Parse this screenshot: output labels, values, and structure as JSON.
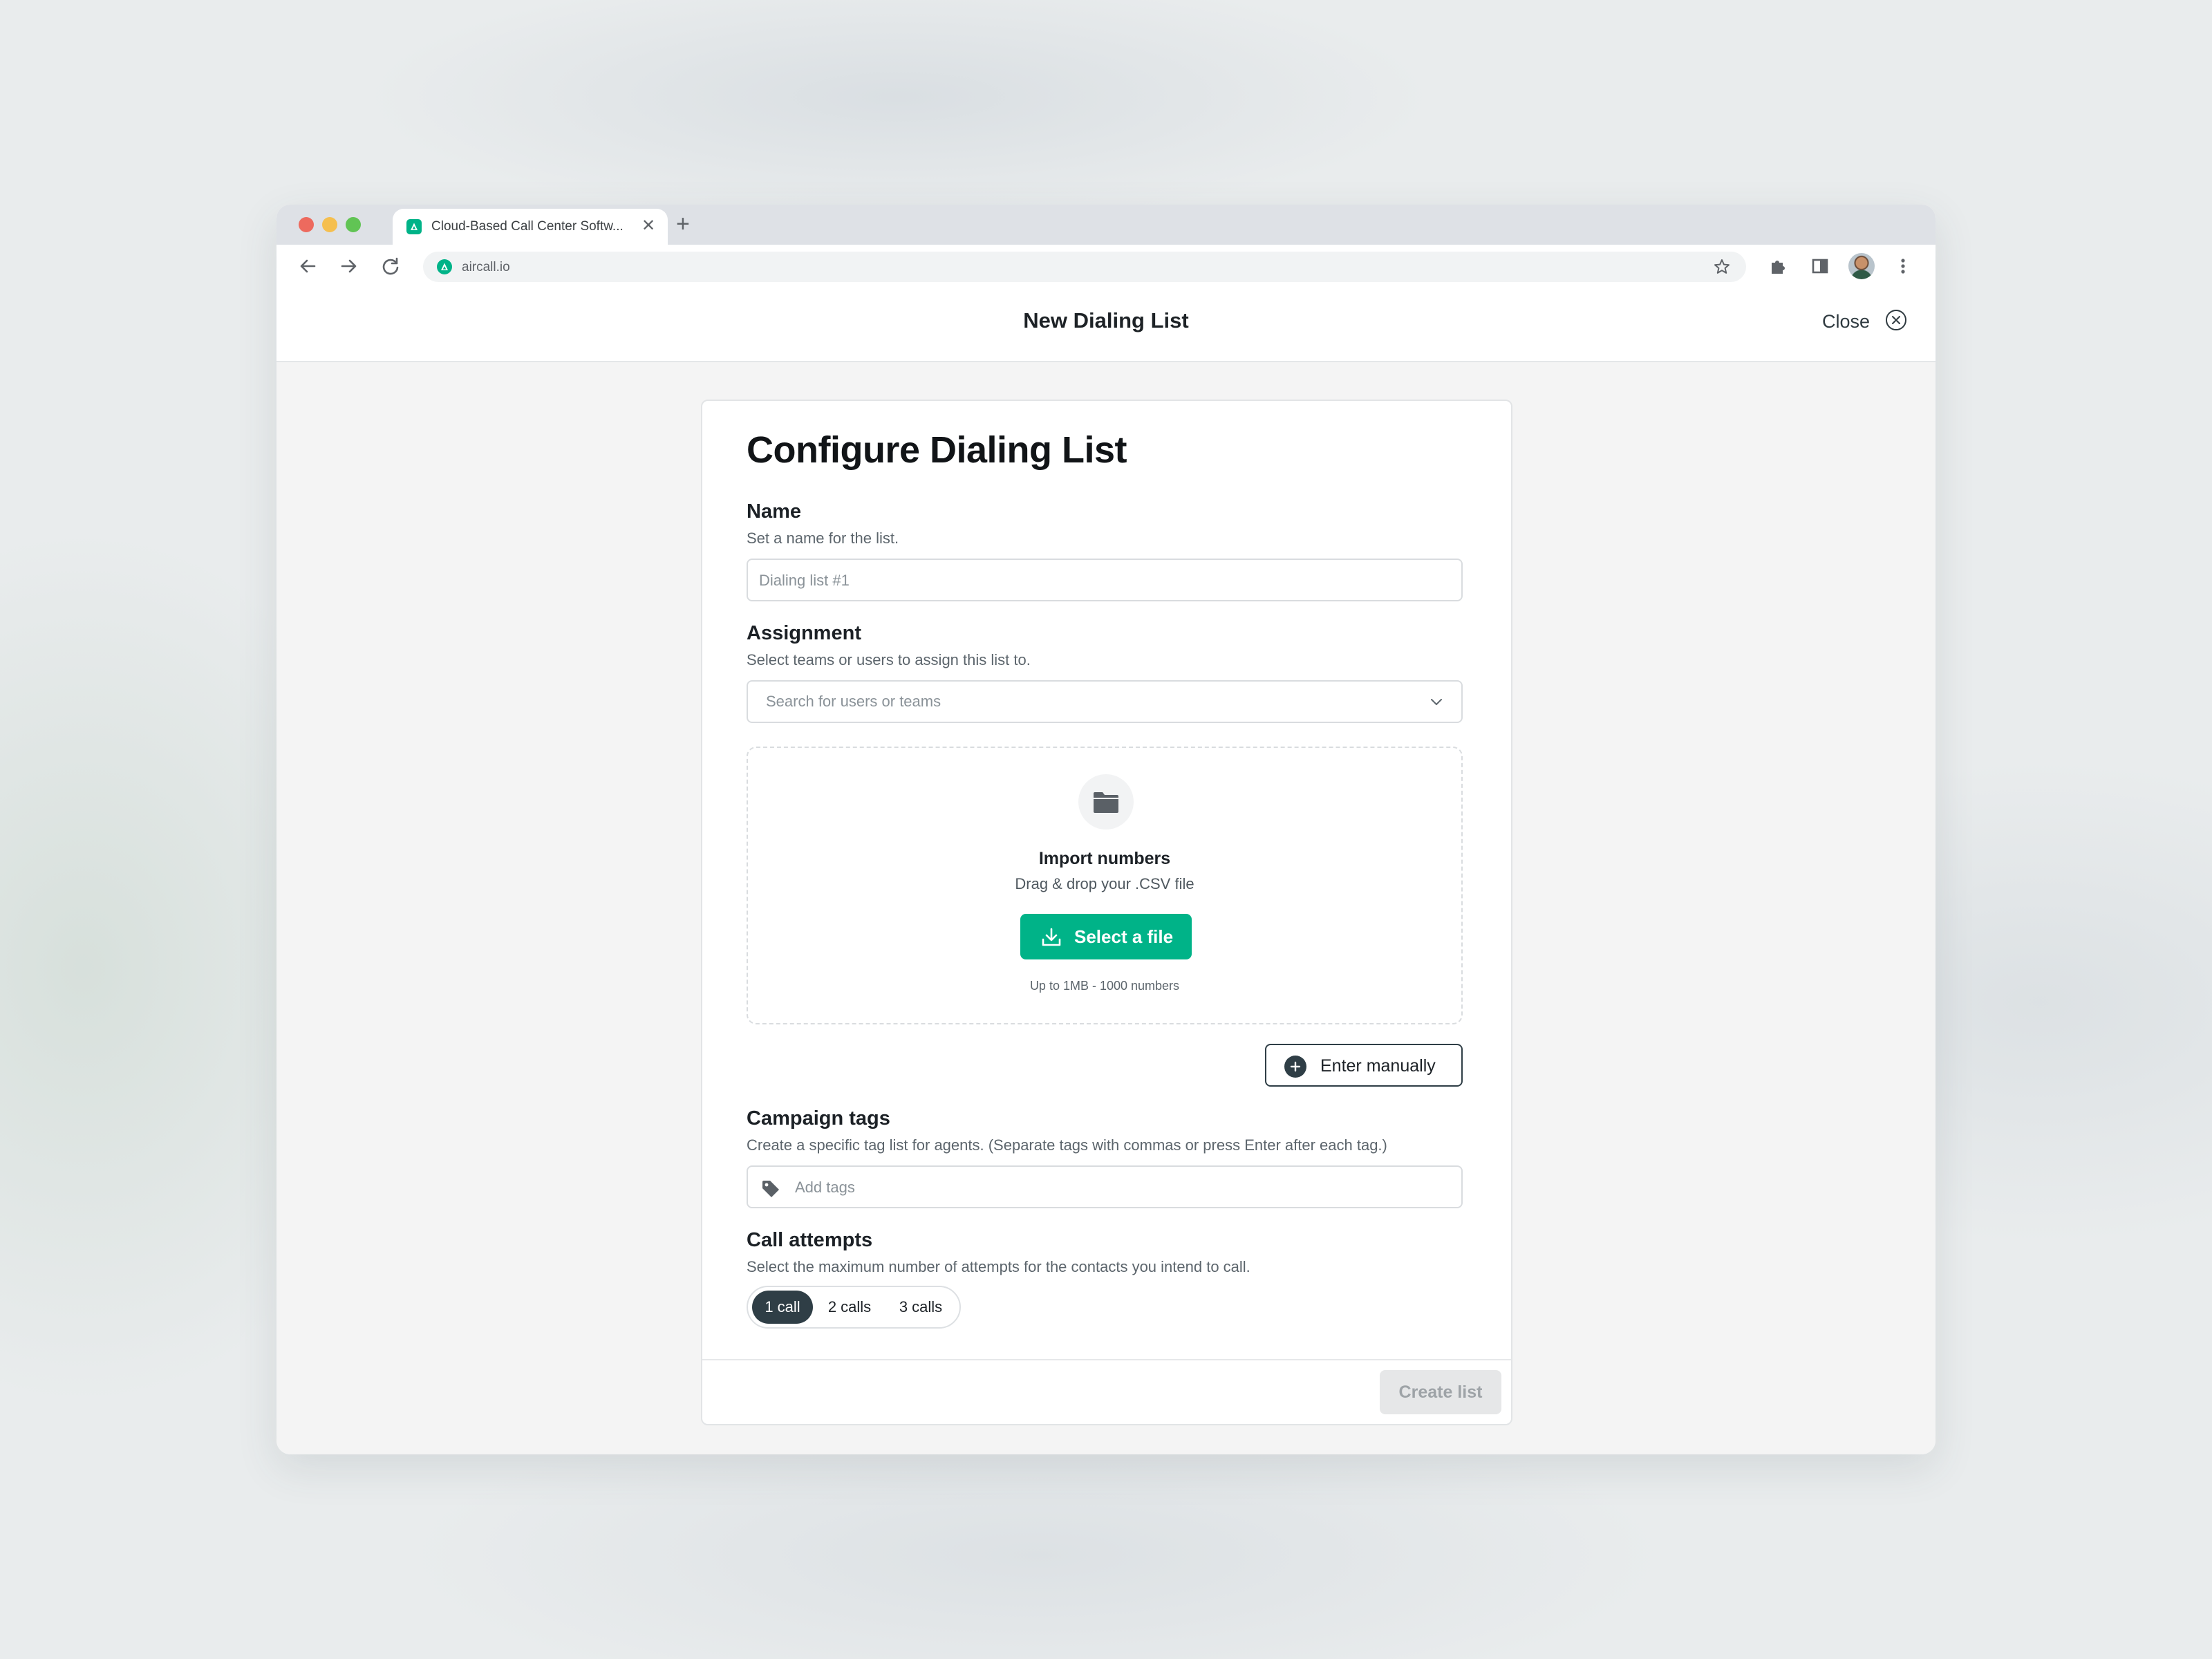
{
  "browser": {
    "tab_title": "Cloud-Based Call Center Softw...",
    "tab_close": "✕",
    "new_tab": "+",
    "url": "aircall.io"
  },
  "header": {
    "title": "New Dialing List",
    "close_label": "Close"
  },
  "form": {
    "title": "Configure Dialing List",
    "name": {
      "label": "Name",
      "hint": "Set a name for the list.",
      "value": "",
      "placeholder": "Dialing list #1"
    },
    "assignment": {
      "label": "Assignment",
      "hint": "Select teams or users to assign this list to.",
      "placeholder": "Search for users or teams"
    },
    "import": {
      "title": "Import numbers",
      "subtitle": "Drag & drop your .CSV file",
      "button": "Select a file",
      "limit": "Up to 1MB - 1000 numbers"
    },
    "enter_manually": "Enter manually",
    "campaign_tags": {
      "label": "Campaign tags",
      "hint": "Create a specific tag list for agents. (Separate tags with commas or press Enter after each tag.)",
      "placeholder": "Add tags"
    },
    "call_attempts": {
      "label": "Call attempts",
      "hint": "Select the maximum number of attempts for the contacts you intend to call.",
      "options": [
        "1 call",
        "2 calls",
        "3 calls"
      ],
      "selected": "1 call"
    },
    "create_button": "Create list"
  },
  "colors": {
    "accent": "#00b388",
    "dark": "#2f3e46",
    "disabled": "#e6e7e8"
  },
  "icons": [
    "back-arrow-icon",
    "forward-arrow-icon",
    "reload-icon",
    "star-icon",
    "extension-puzzle-icon",
    "side-panel-icon",
    "kebab-menu-icon",
    "close-circle-icon",
    "folder-icon",
    "download-icon",
    "plus-circle-icon",
    "tag-icon",
    "chevron-down-icon"
  ]
}
